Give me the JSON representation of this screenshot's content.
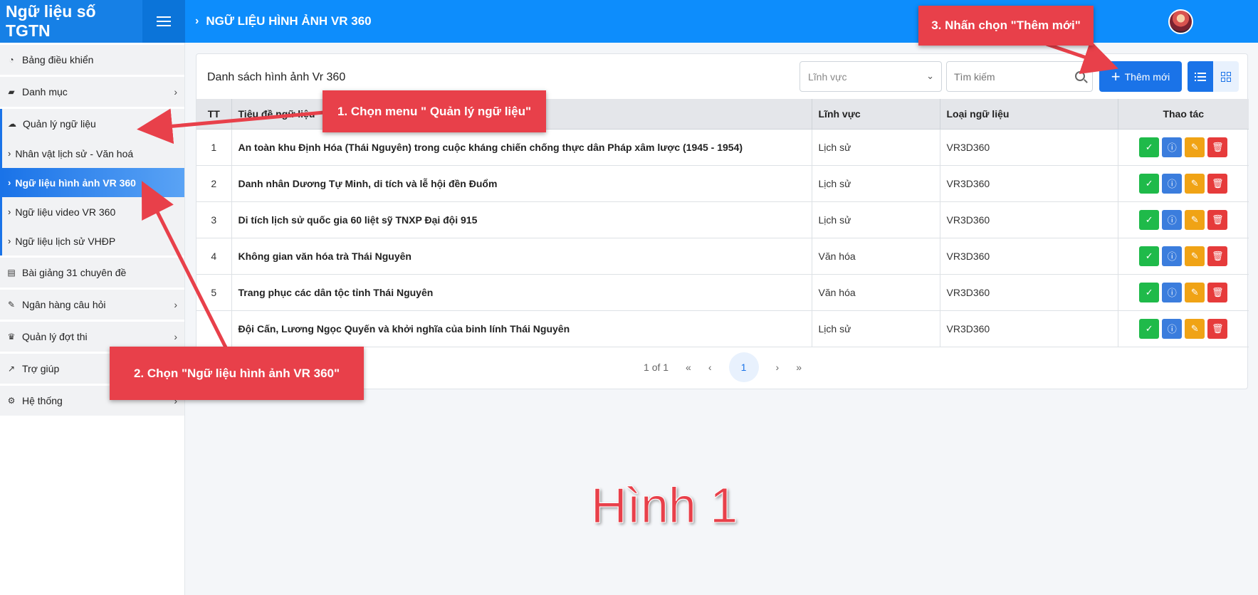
{
  "app": {
    "brand": "Ngữ liệu số TGTN",
    "breadcrumb": "NGỮ LIỆU HÌNH ẢNH VR 360"
  },
  "sidebar": {
    "items": [
      {
        "label": "Bảng điều khiển",
        "icon": "dashboard-icon"
      },
      {
        "label": "Danh mục",
        "icon": "folder-icon"
      },
      {
        "label": "Quản lý ngữ liệu",
        "icon": "cloud-icon"
      },
      {
        "label": "Bài giảng 31 chuyên đề",
        "icon": "book-icon"
      },
      {
        "label": "Ngân hàng câu hỏi",
        "icon": "edit-icon"
      },
      {
        "label": "Quản lý đợt thi",
        "icon": "trophy-icon"
      },
      {
        "label": "Trợ giúp",
        "icon": "chart-icon"
      },
      {
        "label": "Hệ thống",
        "icon": "gears-icon"
      }
    ],
    "subitems": [
      {
        "label": "Nhân vật lịch sử - Văn hoá"
      },
      {
        "label": "Ngữ liệu hình ảnh VR 360"
      },
      {
        "label": "Ngữ liệu video VR 360"
      },
      {
        "label": "Ngữ liệu lịch sử VHĐP"
      }
    ]
  },
  "main": {
    "card_title": "Danh sách hình ảnh Vr 360",
    "field_select": "Lĩnh vực",
    "search_placeholder": "Tìm kiếm",
    "add_label": "Thêm mới",
    "columns": [
      "TT",
      "Tiêu đề ngữ liệu",
      "Lĩnh vực",
      "Loại ngữ liệu",
      "Thao tác"
    ],
    "rows": [
      {
        "tt": "1",
        "title": "An toàn khu Định Hóa (Thái Nguyên) trong cuộc kháng chiến chống thực dân Pháp xâm lược (1945 - 1954)",
        "field": "Lịch sử",
        "type": "VR3D360"
      },
      {
        "tt": "2",
        "title": "Danh nhân Dương Tự Minh, di tích và lễ hội đền Đuổm",
        "field": "Lịch sử",
        "type": "VR3D360"
      },
      {
        "tt": "3",
        "title": "Di tích lịch sử quốc gia 60 liệt sỹ TNXP Đại đội 915",
        "field": "Lịch sử",
        "type": "VR3D360"
      },
      {
        "tt": "4",
        "title": "Không gian văn hóa trà Thái Nguyên",
        "field": "Văn hóa",
        "type": "VR3D360"
      },
      {
        "tt": "5",
        "title": "Trang phục các dân tộc tỉnh Thái Nguyên",
        "field": "Văn hóa",
        "type": "VR3D360"
      },
      {
        "tt": "",
        "title": "Đội Cấn, Lương Ngọc Quyến và khởi nghĩa của binh lính Thái Nguyên",
        "field": "Lịch sử",
        "type": "VR3D360"
      }
    ],
    "pagination": {
      "info": "1 of 1",
      "current": "1"
    }
  },
  "annotations": {
    "step1": "1. Chọn menu \" Quản lý ngữ liệu\"",
    "step2": "2. Chọn \"Ngữ liệu hình ảnh VR 360\"",
    "step3": "3. Nhấn chọn \"Thêm mới\"",
    "figure": "Hình 1"
  },
  "colors": {
    "header": "#0d8dfc",
    "accent": "#1a73e8",
    "callout": "#e8404a",
    "ok": "#1fba4a",
    "info": "#3b7ddd",
    "edit": "#f0a315",
    "delete": "#e63b3b"
  }
}
